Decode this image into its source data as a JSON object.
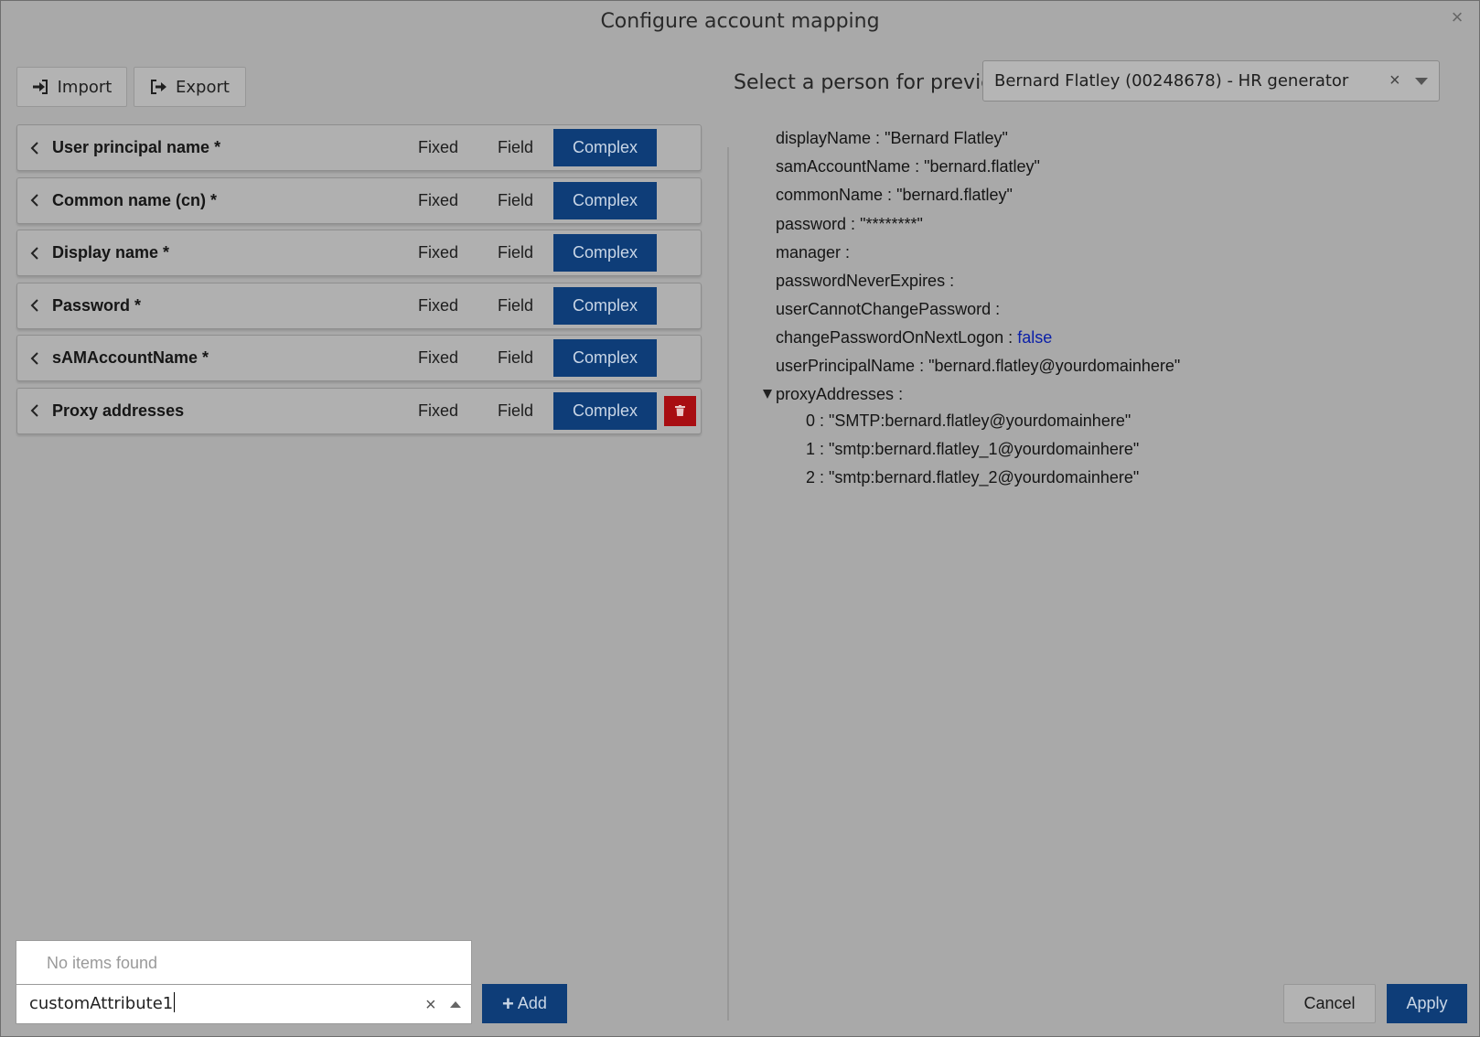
{
  "dialog": {
    "title": "Configure account mapping",
    "close_glyph": "×"
  },
  "toolbar": {
    "import_label": "Import",
    "export_label": "Export"
  },
  "mapping_rows": [
    {
      "label": "User principal name *",
      "fixed": "Fixed",
      "field": "Field",
      "complex": "Complex",
      "selected": "Complex"
    },
    {
      "label": "Common name (cn) *",
      "fixed": "Fixed",
      "field": "Field",
      "complex": "Complex",
      "selected": "Complex"
    },
    {
      "label": "Display name *",
      "fixed": "Fixed",
      "field": "Field",
      "complex": "Complex",
      "selected": "Complex"
    },
    {
      "label": "Password *",
      "fixed": "Fixed",
      "field": "Field",
      "complex": "Complex",
      "selected": "Complex"
    },
    {
      "label": "sAMAccountName *",
      "fixed": "Fixed",
      "field": "Field",
      "complex": "Complex",
      "selected": "Complex"
    },
    {
      "label": "Proxy addresses",
      "fixed": "Fixed",
      "field": "Field",
      "complex": "Complex",
      "selected": "Complex",
      "deletable": true
    }
  ],
  "preview": {
    "label": "Select a person for preview",
    "selected_person": "Bernard Flatley (00248678) - HR generator",
    "clear_glyph": "×",
    "lines": [
      {
        "key": "displayName",
        "sep": " : ",
        "value": "\"Bernard Flatley\""
      },
      {
        "key": "samAccountName",
        "sep": " : ",
        "value": "\"bernard.flatley\""
      },
      {
        "key": "commonName",
        "sep": " : ",
        "value": "\"bernard.flatley\""
      },
      {
        "key": "password",
        "sep": " : ",
        "value": "\"********\""
      },
      {
        "key": "manager",
        "sep": " :",
        "value": ""
      },
      {
        "key": "passwordNeverExpires",
        "sep": " :",
        "value": ""
      },
      {
        "key": "userCannotChangePassword",
        "sep": " :",
        "value": ""
      },
      {
        "key": "changePasswordOnNextLogon",
        "sep": " : ",
        "value": "false"
      },
      {
        "key": "userPrincipalName",
        "sep": " : ",
        "value": "\"bernard.flatley@yourdomainhere\""
      },
      {
        "key": "proxyAddresses",
        "sep": " :",
        "value": ""
      },
      {
        "key": "0",
        "sep": " : ",
        "value": "\"SMTP:bernard.flatley@yourdomainhere\""
      },
      {
        "key": "1",
        "sep": " : ",
        "value": "\"smtp:bernard.flatley_1@yourdomainhere\""
      },
      {
        "key": "2",
        "sep": " : ",
        "value": "\"smtp:bernard.flatley_2@yourdomainhere\""
      }
    ]
  },
  "attribute_picker": {
    "no_items_text": "No items found",
    "input_value": "customAttribute1",
    "clear_glyph": "×",
    "add_label": "Add",
    "add_glyph": "+"
  },
  "footer": {
    "cancel_label": "Cancel",
    "apply_label": "Apply"
  }
}
